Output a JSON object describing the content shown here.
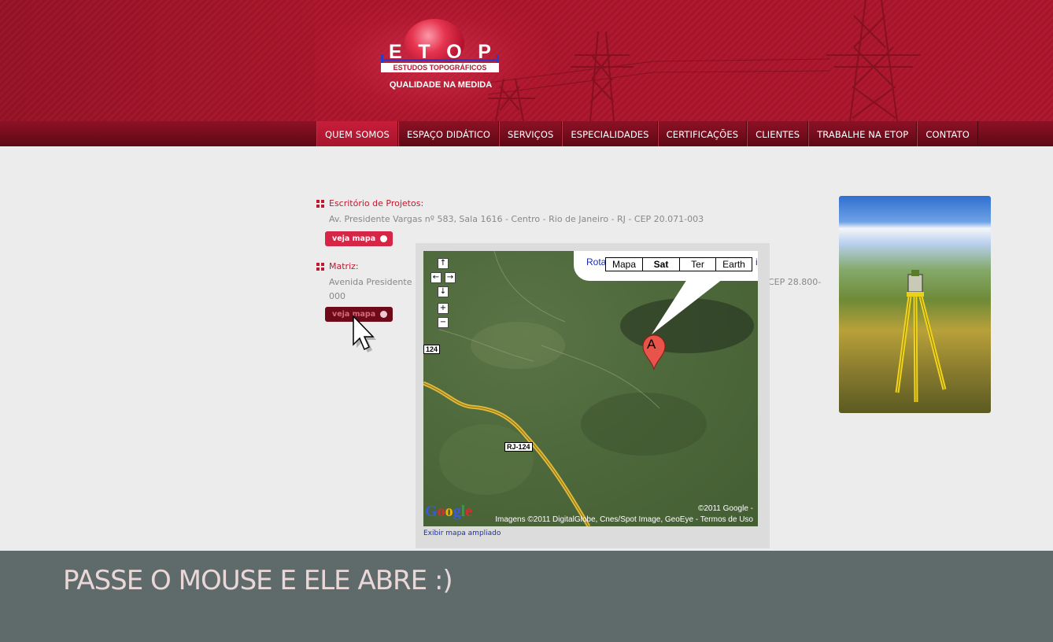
{
  "logo": {
    "letters": [
      "E",
      "T",
      "O",
      "P"
    ],
    "subtitle": "ESTUDOS TOPOGRÁFICOS",
    "tagline": "QUALIDADE NA MEDIDA"
  },
  "nav": {
    "items": [
      {
        "label": "QUEM SOMOS",
        "active": true
      },
      {
        "label": "ESPAÇO DIDÁTICO"
      },
      {
        "label": "SERVIÇOS"
      },
      {
        "label": "ESPECIALIDADES"
      },
      {
        "label": "CERTIFICAÇÕES"
      },
      {
        "label": "CLIENTES"
      },
      {
        "label": "TRABALHE NA ETOP"
      },
      {
        "label": "CONTATO"
      }
    ]
  },
  "offices": [
    {
      "title": "Escritório de Projetos:",
      "address": "Av. Presidente Vargas nº 583, Sala 1616 - Centro - Rio de Janeiro - RJ - CEP 20.071-003",
      "button": "veja mapa"
    },
    {
      "title": "Matriz:",
      "address_start": "Avenida Presidente",
      "address_end": "CEP 28.800-",
      "address_line2": "000",
      "button": "veja mapa"
    }
  ],
  "map": {
    "route_label": "Rota",
    "types": [
      "Mapa",
      "Sat",
      "Ter",
      "Earth"
    ],
    "selected_type": "Sat",
    "marker_label": "A",
    "road_labels": [
      "124",
      "RJ-124"
    ],
    "pan_controls": [
      "↑",
      "←",
      "→",
      "↓"
    ],
    "zoom_controls": [
      "+",
      "−"
    ],
    "google": [
      "G",
      "o",
      "o",
      "g",
      "l",
      "e"
    ],
    "copyright_1": "©2011 Google -",
    "copyright_2": "Imagens ©2011 DigitalGlobe, Cnes/Spot Image, GeoEye - Termos de Uso",
    "enlarge_link": "Exibir mapa ampliado",
    "edge_char": "i"
  },
  "footer": {
    "caption": "PASSE O MOUSE E ELE ABRE :)"
  },
  "colors": {
    "brand_red": "#b0192f",
    "nav_dark": "#5e0816",
    "button_red": "#d62647",
    "footer_bg": "#5f6b6b",
    "google_blue": "#3b5bdb",
    "google_red": "#d32f2f",
    "google_yellow": "#f4b400",
    "google_green": "#2e9e4a"
  }
}
